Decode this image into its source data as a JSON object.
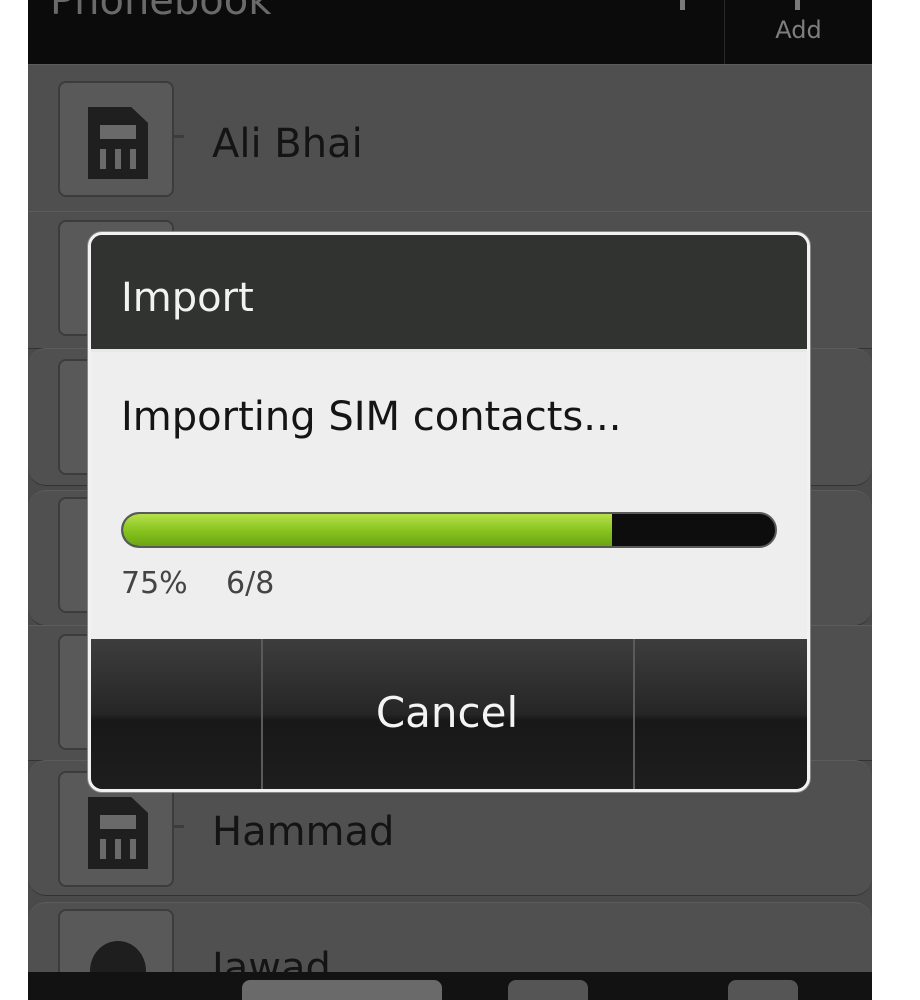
{
  "header": {
    "title": "Phonebook",
    "add_label": "Add",
    "add_icon": "add-icon"
  },
  "contacts": [
    {
      "name": "Ali Bhai",
      "icon": "sim-icon"
    },
    {
      "name": "Hammad",
      "icon": "sim-icon"
    },
    {
      "name": "Jawad",
      "icon": "person-icon"
    }
  ],
  "dialog": {
    "title": "Import",
    "message": "Importing SIM contacts...",
    "progress_percent": 75,
    "progress_label": "75%",
    "progress_count": "6/8",
    "cancel_label": "Cancel"
  },
  "colors": {
    "progress_fill": "#86c21e",
    "dialog_title_bg": "#303330",
    "dialog_body_bg": "#eeeeee"
  }
}
